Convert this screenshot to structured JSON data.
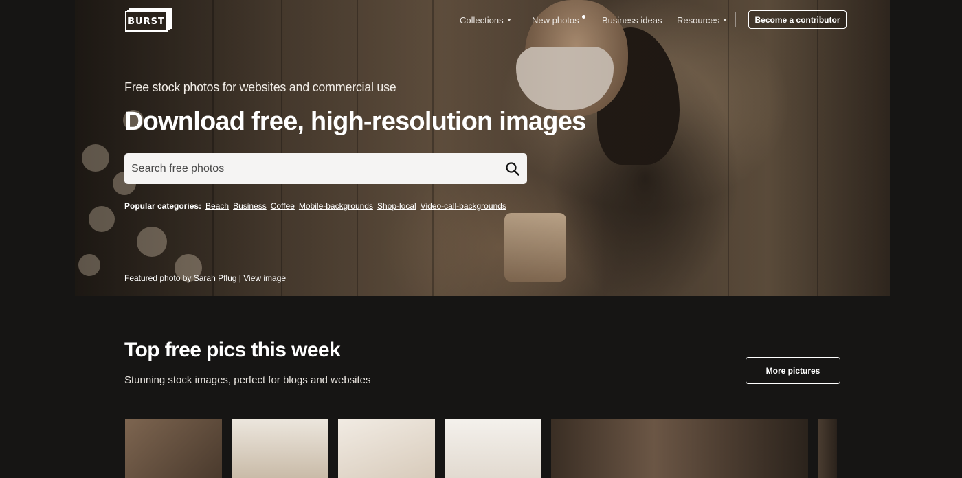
{
  "header": {
    "logo_text": "BURST",
    "nav": [
      {
        "label": "Collections",
        "dropdown": true
      },
      {
        "label": "New photos",
        "dot": true
      },
      {
        "label": "Business ideas"
      },
      {
        "label": "Resources",
        "dropdown": true
      }
    ],
    "contributor_button": "Become a contributor"
  },
  "hero": {
    "subtitle": "Free stock photos for websites and commercial use",
    "title": "Download free, high-resolution images",
    "search": {
      "placeholder": "Search free photos",
      "icon": "search-icon"
    },
    "popular_label": "Popular categories:",
    "categories": [
      "Beach",
      "Business",
      "Coffee",
      "Mobile-backgrounds",
      "Shop-local",
      "Video-call-backgrounds"
    ],
    "credit_text": "Featured photo by Sarah Pflug |",
    "credit_link": "View image"
  },
  "section": {
    "title": "Top free pics this week",
    "subtitle": "Stunning stock images, perfect for blogs and websites",
    "more_button": "More pictures"
  },
  "colors": {
    "background": "#161514",
    "search_bg": "#f5f4f3",
    "text": "#ffffff"
  }
}
